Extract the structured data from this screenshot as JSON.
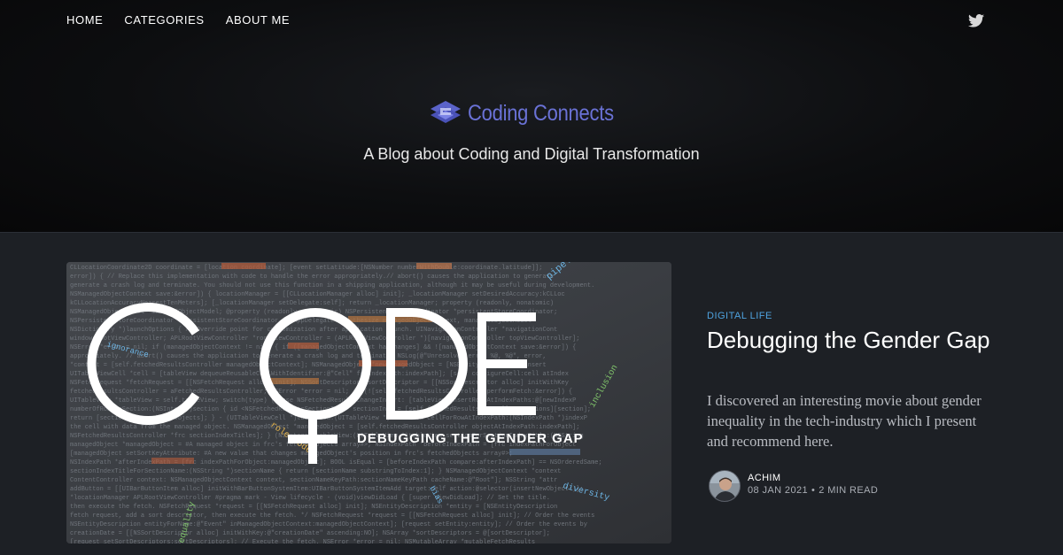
{
  "nav": {
    "items": [
      {
        "label": "HOME"
      },
      {
        "label": "CATEGORIES"
      },
      {
        "label": "ABOUT ME"
      }
    ],
    "social_icon": "twitter-icon"
  },
  "hero": {
    "brand": "Coding Connects",
    "brand_color": "#6a72d6",
    "tagline": "A Blog about Coding and Digital Transformation"
  },
  "post": {
    "tag": "DIGITAL LIFE",
    "tag_color": "#4fa3e0",
    "title": "Debugging the Gender Gap",
    "excerpt": "I discovered an interesting movie about gender inequality in the tech-industry which I present and recommend here.",
    "image": {
      "headline": "CODE",
      "subtitle": "DEBUGGING THE GENDER GAP"
    },
    "author": "ACHIM",
    "date": "08 JAN 2021",
    "separator": "•",
    "read_time": "2 MIN READ"
  }
}
